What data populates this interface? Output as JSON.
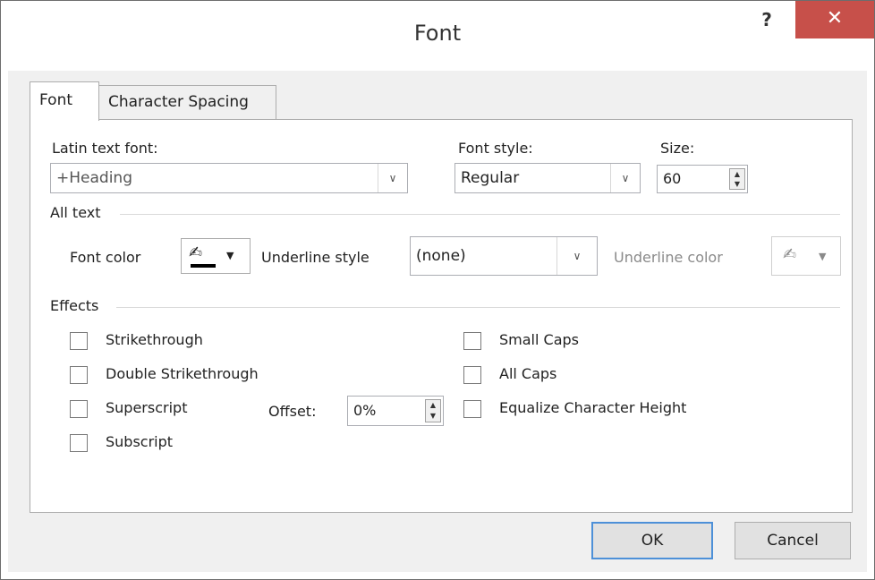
{
  "window": {
    "title": "Font",
    "help_label": "?",
    "close_label": "✕"
  },
  "tabs": [
    {
      "label": "Font",
      "selected": true
    },
    {
      "label": "Character Spacing",
      "selected": false
    }
  ],
  "latin_font": {
    "label": "Latin text font:",
    "value": "+Heading"
  },
  "font_style": {
    "label": "Font style:",
    "value": "Regular"
  },
  "size": {
    "label": "Size:",
    "value": "60"
  },
  "all_text": {
    "heading": "All text",
    "font_color_label": "Font color",
    "underline_style_label": "Underline style",
    "underline_style_value": "(none)",
    "underline_color_label": "Underline color"
  },
  "effects": {
    "heading": "Effects",
    "strikethrough": "Strikethrough",
    "double_strikethrough": "Double Strikethrough",
    "superscript": "Superscript",
    "subscript": "Subscript",
    "offset_label": "Offset:",
    "offset_value": "0%",
    "small_caps": "Small Caps",
    "all_caps": "All Caps",
    "equalize": "Equalize Character Height"
  },
  "buttons": {
    "ok": "OK",
    "cancel": "Cancel"
  },
  "colors": {
    "close": "#c7504a",
    "font_color_swatch": "#000000",
    "ok_border": "#4d90d8"
  }
}
